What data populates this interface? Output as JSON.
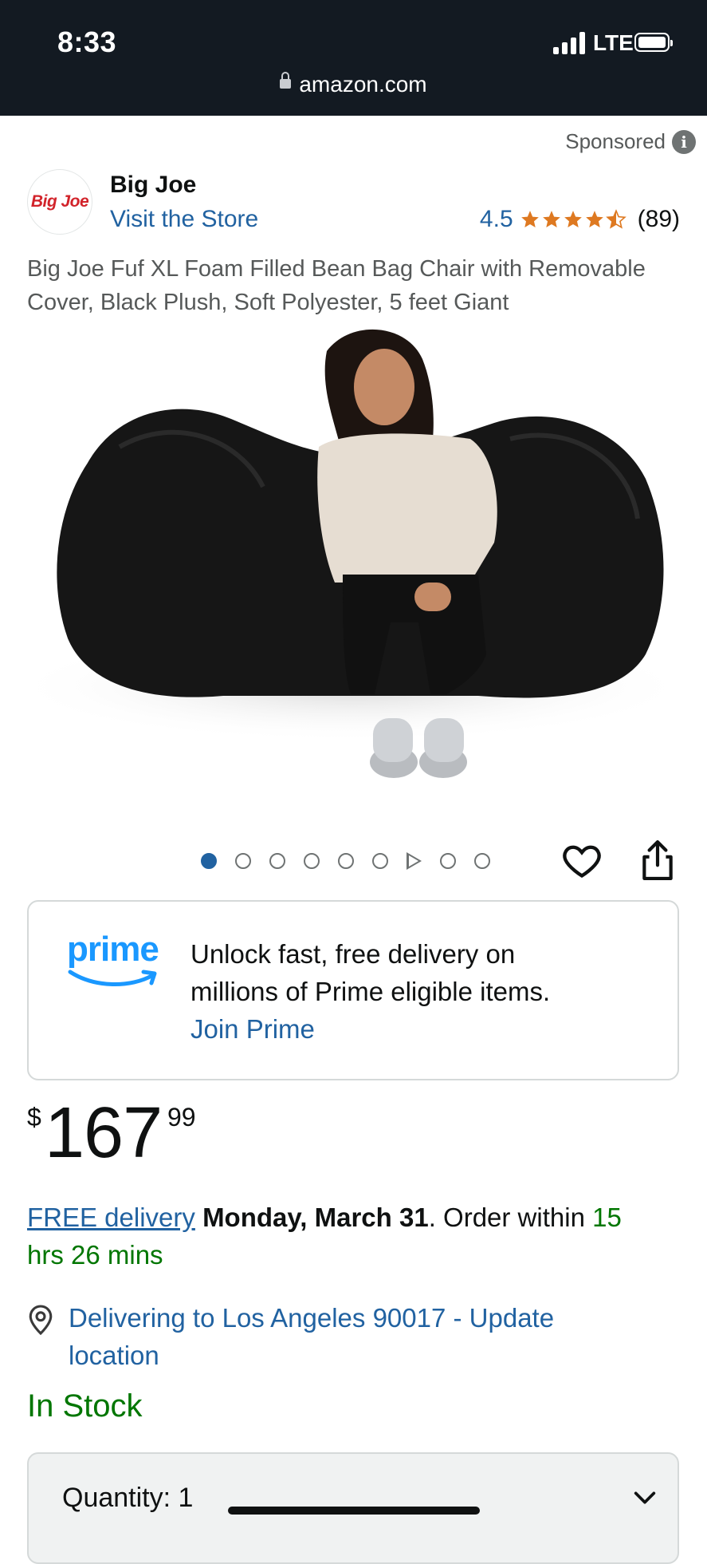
{
  "status_bar": {
    "time": "8:33",
    "network": "LTE"
  },
  "browser": {
    "url": "amazon.com"
  },
  "sponsored_label": "Sponsored",
  "brand": {
    "logo_text": "Big Joe",
    "name": "Big Joe",
    "store_link": "Visit the Store",
    "rating": "4.5",
    "stars": 4.5,
    "review_count": "(89)",
    "star_color": "#de7921"
  },
  "product": {
    "title": "Big Joe Fuf XL Foam Filled Bean Bag Chair with Removable Cover, Black Plush, Soft Polyester, 5 feet Giant"
  },
  "gallery": {
    "image_count": 9,
    "active_index": 0,
    "video_index": 6,
    "icons": [
      "heart-icon",
      "share-icon"
    ]
  },
  "prime": {
    "logo_text": "prime",
    "line1": "Unlock fast, free delivery on",
    "line2": "millions of Prime eligible items.",
    "join_label": "Join Prime"
  },
  "price": {
    "symbol": "$",
    "whole": "167",
    "fraction": "99"
  },
  "delivery": {
    "free_label": "FREE delivery",
    "date": "Monday, March 31",
    "order_within_prefix": ". Order within ",
    "time_left_line1": "15",
    "time_left_line2": "hrs 26 mins"
  },
  "location": {
    "line1": "Delivering to Los Angeles 90017 - Update",
    "line2": "location"
  },
  "stock_status": "In Stock",
  "quantity": {
    "label": "Quantity:",
    "value": "1"
  },
  "colors": {
    "link": "#2162a1",
    "green": "#007600",
    "header": "#131a22",
    "prime_blue": "#1a98ff"
  }
}
